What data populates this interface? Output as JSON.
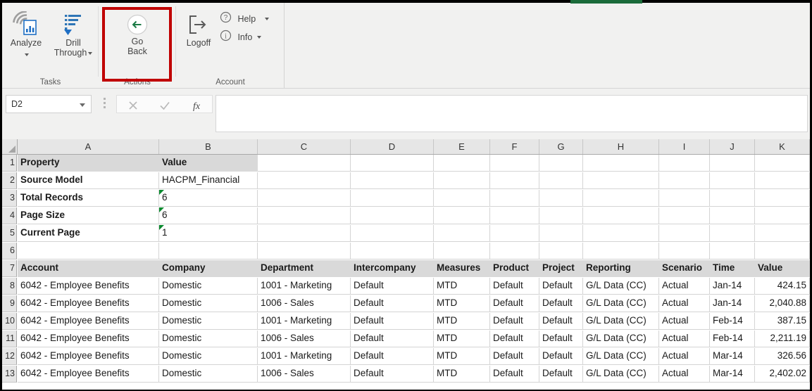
{
  "ribbon": {
    "green_tab_color": "#1b6b3a",
    "highlight_color": "#c00000",
    "groups": [
      {
        "label": "Tasks"
      },
      {
        "label": "Actions"
      },
      {
        "label": "Account"
      }
    ],
    "buttons": {
      "analyze": {
        "label": "Analyze",
        "icon": "analyze-icon",
        "has_dropdown": true
      },
      "drill_through": {
        "label_line1": "Drill",
        "label_line2": "Through",
        "icon": "drill-through-icon",
        "has_dropdown": true
      },
      "go_back": {
        "label_line1": "Go",
        "label_line2": "Back",
        "icon": "go-back-arrow-icon",
        "accent": "#1b7a45",
        "highlighted": true
      },
      "logoff": {
        "label": "Logoff",
        "icon": "logoff-icon"
      },
      "help": {
        "label": "Help",
        "icon": "question-circle-icon",
        "has_dropdown": true
      },
      "info": {
        "label": "Info",
        "icon": "info-circle-icon",
        "has_dropdown": true
      }
    }
  },
  "formula_bar": {
    "name_box": {
      "value": "D2"
    },
    "cancel_icon": "cancel-x-icon",
    "enter_icon": "enter-check-icon",
    "function_icon": "insert-function-fx-icon",
    "input_value": "",
    "input_placeholder": ""
  },
  "grid": {
    "column_headers": [
      "A",
      "B",
      "C",
      "D",
      "E",
      "F",
      "G",
      "H",
      "I",
      "J",
      "K"
    ],
    "row_headers": [
      "1",
      "2",
      "3",
      "4",
      "5",
      "6",
      "7",
      "8",
      "9",
      "10",
      "11",
      "12",
      "13"
    ],
    "selected_cell": "D2",
    "info_block": {
      "header": {
        "property": "Property",
        "value": "Value"
      },
      "rows": [
        {
          "property": "Source Model",
          "value": "HACPM_Financial",
          "error_flag": false
        },
        {
          "property": "Total Records",
          "value": "6",
          "error_flag": true
        },
        {
          "property": "Page Size",
          "value": "6",
          "error_flag": true
        },
        {
          "property": "Current Page",
          "value": "1",
          "error_flag": true
        }
      ]
    },
    "table": {
      "headers": [
        "Account",
        "Company",
        "Department",
        "Intercompany",
        "Measures",
        "Product",
        "Project",
        "Reporting",
        "Scenario",
        "Time",
        "Value"
      ],
      "rows": [
        [
          "6042 - Employee Benefits",
          "Domestic",
          "1001 - Marketing",
          "Default",
          "MTD",
          "Default",
          "Default",
          "G/L Data (CC)",
          "Actual",
          "Jan-14",
          "424.15"
        ],
        [
          "6042 - Employee Benefits",
          "Domestic",
          "1006 - Sales",
          "Default",
          "MTD",
          "Default",
          "Default",
          "G/L Data (CC)",
          "Actual",
          "Jan-14",
          "2,040.88"
        ],
        [
          "6042 - Employee Benefits",
          "Domestic",
          "1001 - Marketing",
          "Default",
          "MTD",
          "Default",
          "Default",
          "G/L Data (CC)",
          "Actual",
          "Feb-14",
          "387.15"
        ],
        [
          "6042 - Employee Benefits",
          "Domestic",
          "1006 - Sales",
          "Default",
          "MTD",
          "Default",
          "Default",
          "G/L Data (CC)",
          "Actual",
          "Feb-14",
          "2,211.19"
        ],
        [
          "6042 - Employee Benefits",
          "Domestic",
          "1001 - Marketing",
          "Default",
          "MTD",
          "Default",
          "Default",
          "G/L Data (CC)",
          "Actual",
          "Mar-14",
          "326.56"
        ],
        [
          "6042 - Employee Benefits",
          "Domestic",
          "1006 - Sales",
          "Default",
          "MTD",
          "Default",
          "Default",
          "G/L Data (CC)",
          "Actual",
          "Mar-14",
          "2,402.02"
        ]
      ]
    }
  }
}
